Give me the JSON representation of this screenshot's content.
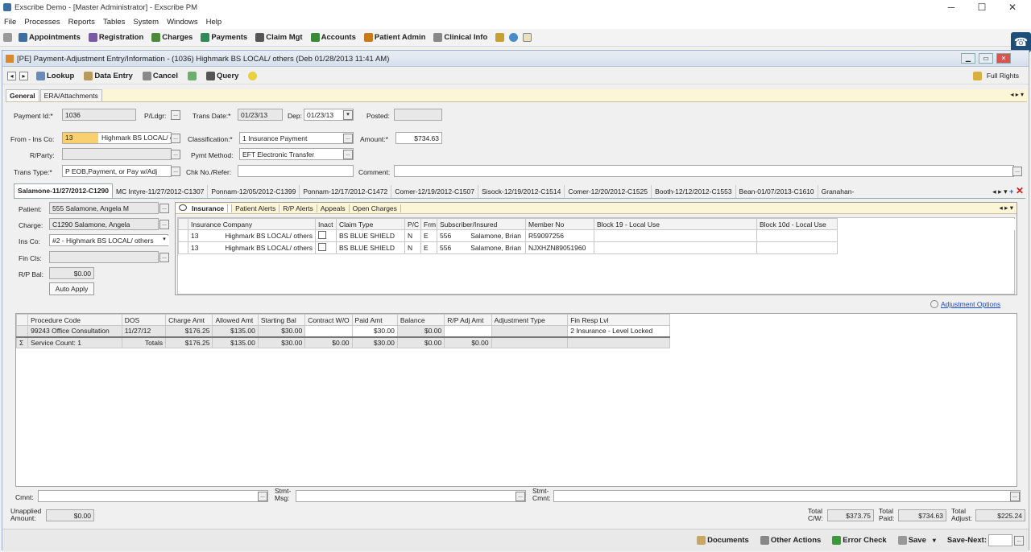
{
  "window": {
    "title": "Exscribe Demo - [Master Administrator] - Exscribe PM",
    "min": "─",
    "max": "☐",
    "close": "✕"
  },
  "menu": [
    "File",
    "Processes",
    "Reports",
    "Tables",
    "System",
    "Windows",
    "Help"
  ],
  "mainbar": [
    {
      "label": "Appointments",
      "icon": "calendar-icon",
      "color": "#3a6ea5"
    },
    {
      "label": "Registration",
      "icon": "registration-icon",
      "color": "#7a5aa5"
    },
    {
      "label": "Charges",
      "icon": "charges-icon",
      "color": "#4a8a3a"
    },
    {
      "label": "Payments",
      "icon": "payments-icon",
      "color": "#2e8b57"
    },
    {
      "label": "Claim Mgt",
      "icon": "claim-icon",
      "color": "#555"
    },
    {
      "label": "Accounts",
      "icon": "accounts-icon",
      "color": "#3a8a3a"
    },
    {
      "label": "Patient Admin",
      "icon": "patient-admin-icon",
      "color": "#c87a1a"
    },
    {
      "label": "Clinical Info",
      "icon": "clinical-icon",
      "color": "#888"
    }
  ],
  "doc": {
    "title": "[PE] Payment-Adjustment Entry/Information - (1036) Highmark BS LOCAL/ others (Deb 01/28/2013 11:41 AM)",
    "rights": "Full Rights"
  },
  "toolbar": {
    "lookup": "Lookup",
    "data_entry": "Data Entry",
    "cancel": "Cancel",
    "query": "Query"
  },
  "tabs": [
    "General",
    "ERA/Attachments"
  ],
  "form": {
    "payment_id_lbl": "Payment Id:*",
    "payment_id": "1036",
    "pldgr_lbl": "P/Ldgr:",
    "trans_date_lbl": "Trans Date:*",
    "trans_date": "01/23/13",
    "dep_lbl": "Dep:",
    "dep": "01/23/13",
    "posted_lbl": "Posted:",
    "from_ins_lbl": "From - Ins Co:",
    "from_ins_code": "13",
    "from_ins_name": "Highmark BS LOCAL/ o",
    "class_lbl": "Classification:*",
    "class_val": "1     Insurance Payment",
    "amount_lbl": "Amount:*",
    "amount": "$734.63",
    "rparty_lbl": "R/Party:",
    "pymt_method_lbl": "Pymt Method:",
    "pymt_method": "EFT  Electronic Transfer",
    "trans_type_lbl": "Trans Type:*",
    "trans_type": "P   EOB,Payment, or Pay w/Adj",
    "chk_lbl": "Chk No./Refer:",
    "comment_lbl": "Comment:"
  },
  "claim_tabs": [
    "Salamone-11/27/2012-C1290",
    "MC Intyre-11/27/2012-C1307",
    "Ponnam-12/05/2012-C1399",
    "Ponnam-12/17/2012-C1472",
    "Comer-12/19/2012-C1507",
    "Sisock-12/19/2012-C1514",
    "Comer-12/20/2012-C1525",
    "Booth-12/12/2012-C1553",
    "Bean-01/07/2013-C1610",
    "Granahan-01/("
  ],
  "left": {
    "patient_lbl": "Patient:",
    "patient": "555        Salamone, Angela M",
    "charge_lbl": "Charge:",
    "charge": "C1290   Salamone, Angela",
    "insco_lbl": "Ins Co:",
    "insco": "#2 - Highmark BS LOCAL/ others",
    "fincls_lbl": "Fin Cls:",
    "rpbal_lbl": "R/P Bal:",
    "rpbal": "$0.00",
    "auto_apply": "Auto Apply"
  },
  "ins_tabs": [
    "Insurance",
    "Patient Alerts",
    "R/P Alerts",
    "Appeals",
    "Open Charges"
  ],
  "ins_table": {
    "headers": [
      "Insurance Company",
      "Inact",
      "Claim Type",
      "P/C",
      "Frm",
      "Subscriber/Insured",
      "Member No",
      "Block 19 - Local Use",
      "Block 10d - Local Use"
    ],
    "rows": [
      [
        "13",
        "Highmark BS LOCAL/ others",
        "",
        "BS  BLUE SHIELD",
        "N",
        "E",
        "556",
        "Salamone, Brian",
        "R59097256",
        "",
        ""
      ],
      [
        "13",
        "Highmark BS LOCAL/ others",
        "",
        "BS  BLUE SHIELD",
        "N",
        "E",
        "556",
        "Salamone, Brian",
        "NJXHZN89051960",
        "",
        ""
      ]
    ]
  },
  "adj_options": "Adjustment Options",
  "proc_table": {
    "headers": [
      "Procedure Code",
      "DOS",
      "Charge Amt",
      "Allowed Amt",
      "Starting Bal",
      "Contract W/O",
      "Paid Amt",
      "Balance",
      "R/P Adj Amt",
      "Adjustment Type",
      "Fin Resp Lvl"
    ],
    "row": [
      "99243   Office Consultation",
      "11/27/12",
      "$176.25",
      "$135.00",
      "$30.00",
      "",
      "$30.00",
      "$0.00",
      "",
      "",
      "2       Insurance - Level Locked"
    ],
    "total": [
      "Service Count: 1",
      "Totals",
      "$176.25",
      "$135.00",
      "$30.00",
      "$0.00",
      "$30.00",
      "$0.00",
      "$0.00",
      "",
      ""
    ]
  },
  "bottom": {
    "cmnt_lbl": "Cmnt:",
    "stmt_msg_lbl": "Stmt-\nMsg:",
    "stmt_cmnt_lbl": "Stmt-\nCmnt:",
    "unapplied_lbl": "Unapplied\nAmount:",
    "unapplied": "$0.00",
    "total_cw_lbl": "Total\nC/W:",
    "total_cw": "$373.75",
    "total_paid_lbl": "Total\nPaid:",
    "total_paid": "$734.63",
    "total_adjust_lbl": "Total\nAdjust:",
    "total_adjust": "$225.24"
  },
  "actions": {
    "documents": "Documents",
    "other_actions": "Other Actions",
    "error_check": "Error Check",
    "save": "Save",
    "save_next": "Save-Next:"
  }
}
